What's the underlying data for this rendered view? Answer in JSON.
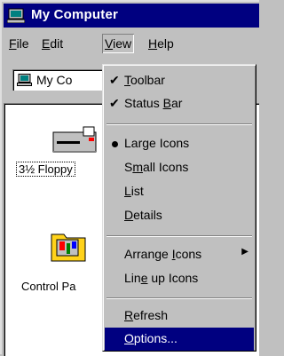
{
  "window": {
    "title": "My Computer"
  },
  "menubar": {
    "items": [
      {
        "label": "File",
        "accel": "F",
        "rest": "ile"
      },
      {
        "label": "Edit",
        "accel": "E",
        "rest": "dit"
      },
      {
        "label": "View",
        "accel": "V",
        "rest": "iew"
      },
      {
        "label": "Help",
        "accel": "H",
        "rest": "elp"
      }
    ]
  },
  "address": {
    "value": "My Co"
  },
  "icons": [
    {
      "label": "3½ Floppy"
    },
    {
      "label": "Control Pa"
    }
  ],
  "view_menu": {
    "items": [
      {
        "pre": "",
        "accel": "T",
        "post": "oolbar",
        "label": "Toolbar",
        "mark": "✔"
      },
      {
        "pre": "Status ",
        "accel": "B",
        "post": "ar",
        "label": "Status Bar",
        "mark": "✔"
      },
      {
        "pre": "Lar",
        "accel": "g",
        "post": "e Icons",
        "label": "Large Icons",
        "mark": "bullet"
      },
      {
        "pre": "S",
        "accel": "m",
        "post": "all Icons",
        "label": "Small Icons"
      },
      {
        "pre": "",
        "accel": "L",
        "post": "ist",
        "label": "List"
      },
      {
        "pre": "",
        "accel": "D",
        "post": "etails",
        "label": "Details"
      },
      {
        "pre": "Arrange ",
        "accel": "I",
        "post": "cons",
        "label": "Arrange Icons",
        "arrow": "▶"
      },
      {
        "pre": "Lin",
        "accel": "e",
        "post": " up Icons",
        "label": "Line up Icons"
      },
      {
        "pre": "",
        "accel": "R",
        "post": "efresh",
        "label": "Refresh"
      },
      {
        "pre": "",
        "accel": "O",
        "post": "ptions...",
        "label": "Options..."
      }
    ]
  },
  "colors": {
    "titlebar": "#000080",
    "face": "#c0c0c0",
    "highlight": "#000080"
  }
}
